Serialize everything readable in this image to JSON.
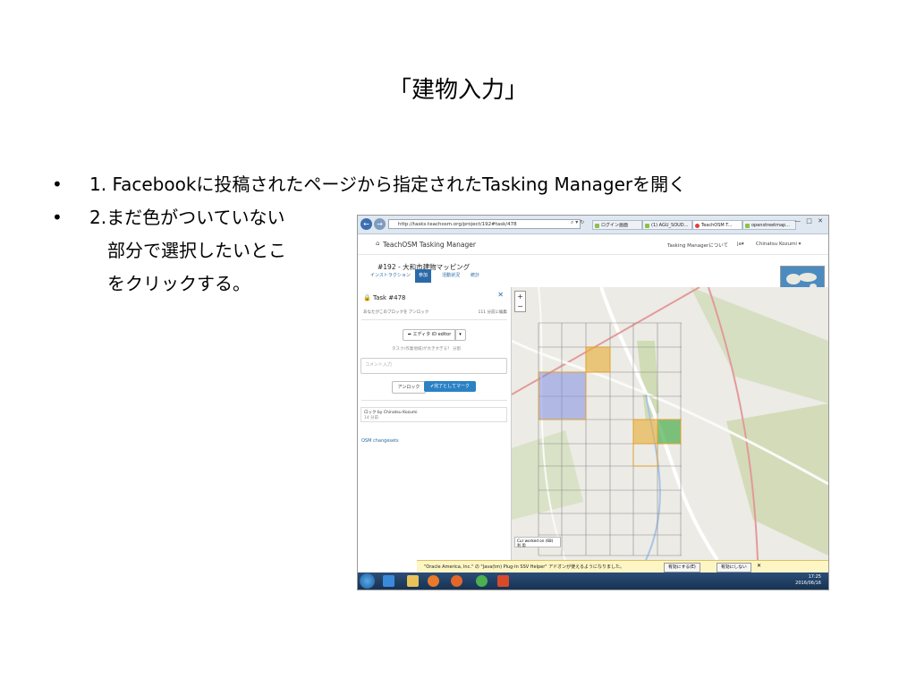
{
  "slide": {
    "title": "「建物入力」",
    "bullets": [
      {
        "marker": "•",
        "text": "1. Facebookに投稿されたページから指定されたTasking Managerを開く"
      },
      {
        "marker": "•",
        "lines": [
          "2.まだ色がついていない",
          "部分で選択したいとこ",
          "をクリックする。"
        ]
      }
    ]
  },
  "screenshot": {
    "browser": {
      "address": "http://tasks.teachosm.org/project/192#task/478",
      "tabs": [
        "ログイン画面",
        "(1) AGU_SOUD...",
        "TeachOSM T...",
        "openstreetmap..."
      ],
      "window_controls": "— □ ✕"
    },
    "header": {
      "brand": "TeachOSM Tasking Manager",
      "about": "Tasking Managerについて",
      "lang": "ja▾",
      "user": "Chinatsu Kozumi ▾"
    },
    "project": {
      "title": "#192 - 大和市建物マッピング",
      "tabs": [
        "インストラクション",
        "参加",
        "活動状況",
        "統計"
      ]
    },
    "task": {
      "title": "Task #478",
      "close": "✕",
      "meta_left": "あなたがこのブロックを アンロック",
      "meta_right": "111 分前に編集",
      "editor_label": "エディタ iD editor",
      "editor_caret": "▾",
      "hint": "タスク(作業地域)が大きすぎる？ 分割",
      "comment_placeholder": "コメント入力",
      "unlock_label": "アンロック",
      "done_label": "✔完了としてマーク",
      "history_text": "ロック by Chinatsu Kozumi",
      "history_time": "14 分前",
      "osm_link": "OSM changesets"
    },
    "map": {
      "zoom_in": "+",
      "zoom_out": "−",
      "legend": [
        "Cur  worked on (68)",
        "利 用"
      ]
    },
    "notification": {
      "text": "\"Oracle America, Inc.\" の \"Java(tm) Plug-In SSV Helper\" アドオンが使えるようになりました。",
      "enable_label": "有効にする(E)",
      "disable_label": "有効にしない",
      "close": "✕"
    },
    "taskbar": {
      "time": "17:25",
      "date": "2016/06/16"
    }
  }
}
